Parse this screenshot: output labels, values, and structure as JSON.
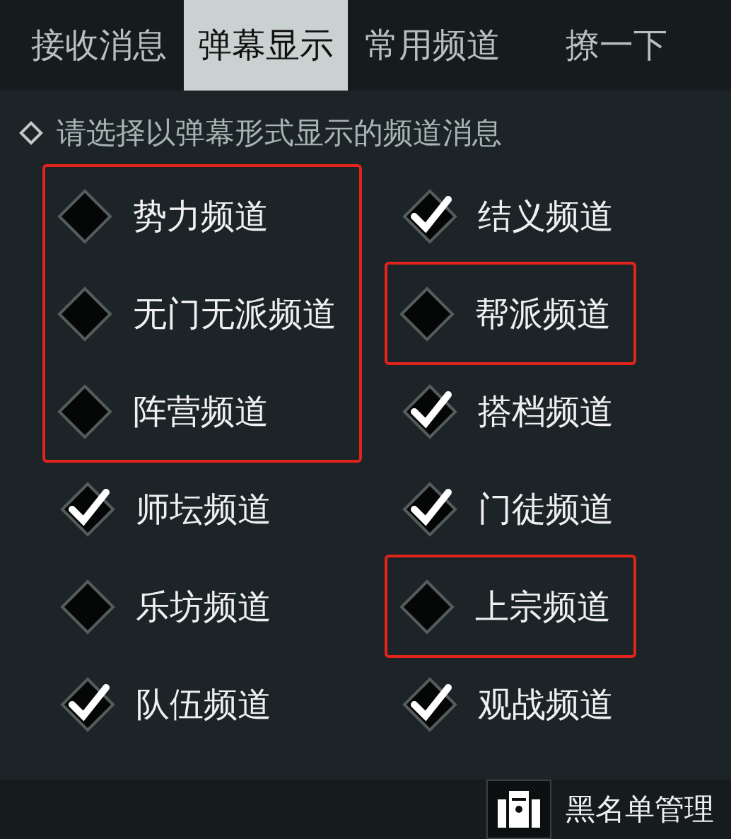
{
  "tabs": [
    {
      "label": "接收消息",
      "selected": false
    },
    {
      "label": "弹幕显示",
      "selected": true
    },
    {
      "label": "常用频道",
      "selected": false
    },
    {
      "label": "撩一下",
      "selected": false
    }
  ],
  "instruction": "请选择以弹幕形式显示的频道消息",
  "columns": [
    [
      {
        "label": "势力频道",
        "checked": false,
        "highlighted": true
      },
      {
        "label": "无门无派频道",
        "checked": false,
        "highlighted": true
      },
      {
        "label": "阵营频道",
        "checked": false,
        "highlighted": true
      },
      {
        "label": "师坛频道",
        "checked": true,
        "highlighted": false
      },
      {
        "label": "乐坊频道",
        "checked": false,
        "highlighted": false
      },
      {
        "label": "队伍频道",
        "checked": true,
        "highlighted": false
      }
    ],
    [
      {
        "label": "结义频道",
        "checked": true,
        "highlighted": false
      },
      {
        "label": "帮派频道",
        "checked": false,
        "highlighted": true
      },
      {
        "label": "搭档频道",
        "checked": true,
        "highlighted": false
      },
      {
        "label": "门徒频道",
        "checked": true,
        "highlighted": false
      },
      {
        "label": "上宗频道",
        "checked": false,
        "highlighted": true
      },
      {
        "label": "观战频道",
        "checked": true,
        "highlighted": false
      }
    ]
  ],
  "footer": {
    "button": "黑名单管理"
  }
}
